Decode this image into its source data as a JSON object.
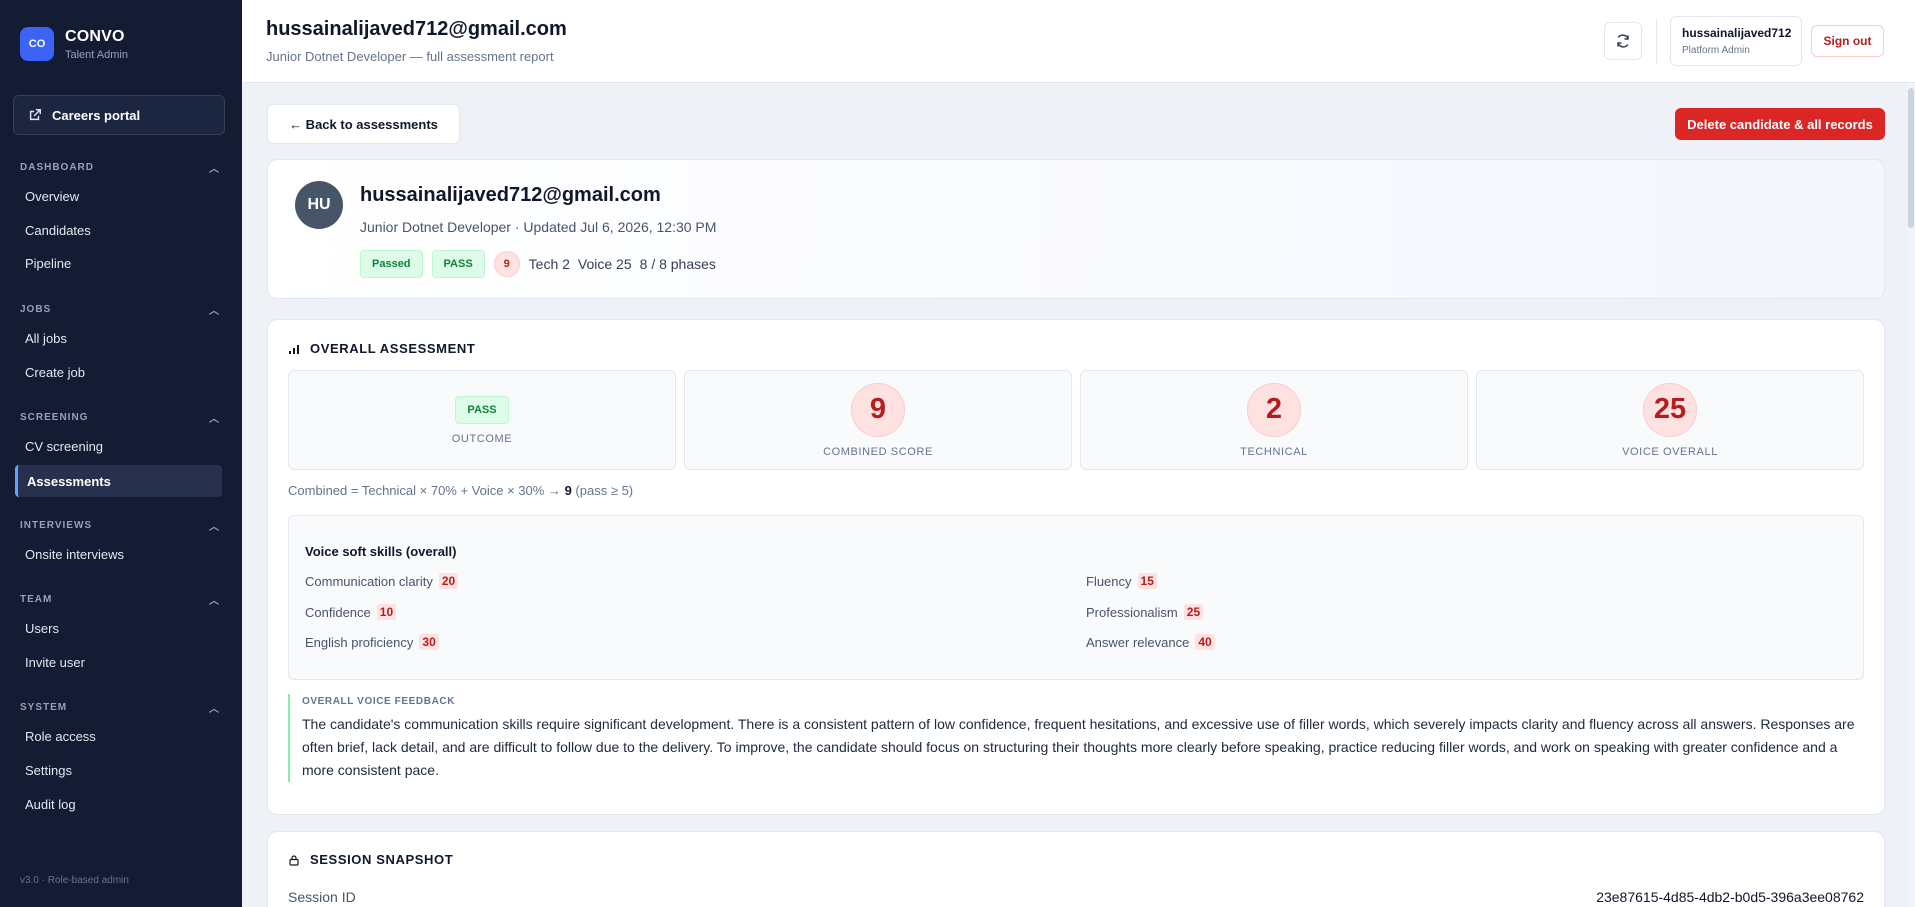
{
  "brand": {
    "logo": "CO",
    "name": "CONVO",
    "sub": "Talent Admin"
  },
  "sidebar": {
    "careers": "Careers portal",
    "sections": [
      {
        "title": "DASHBOARD",
        "items": [
          "Overview",
          "Candidates",
          "Pipeline"
        ]
      },
      {
        "title": "JOBS",
        "items": [
          "All jobs",
          "Create job"
        ]
      },
      {
        "title": "SCREENING",
        "items": [
          "CV screening",
          "Assessments"
        ]
      },
      {
        "title": "INTERVIEWS",
        "items": [
          "Onsite interviews"
        ]
      },
      {
        "title": "TEAM",
        "items": [
          "Users",
          "Invite user"
        ]
      },
      {
        "title": "SYSTEM",
        "items": [
          "Role access",
          "Settings",
          "Audit log"
        ]
      }
    ],
    "active": "Assessments",
    "version": "v3.0 · Role-based admin"
  },
  "header": {
    "title": "hussainalijaved712@gmail.com",
    "subtitle": "Junior Dotnet Developer — full assessment report",
    "user_name": "hussainalijaved712",
    "user_role": "Platform Admin",
    "signout": "Sign out"
  },
  "actions": {
    "back": "← Back to assessments",
    "delete": "Delete candidate & all records"
  },
  "profile": {
    "initials": "HU",
    "name": "hussainalijaved712@gmail.com",
    "meta": "Junior Dotnet Developer · Updated Jul 6, 2026, 12:30 PM",
    "status": "Passed",
    "outcome": "PASS",
    "score": "9",
    "tech": "Tech 2",
    "voice": "Voice 25",
    "phases": "8 / 8 phases"
  },
  "overall": {
    "heading": "OVERALL ASSESSMENT",
    "outcome_value": "PASS",
    "outcome_label": "OUTCOME",
    "combined_value": "9",
    "combined_label": "COMBINED SCORE",
    "technical_value": "2",
    "technical_label": "TECHNICAL",
    "voice_value": "25",
    "voice_label": "VOICE OVERALL",
    "formula_prefix": "Combined = Technical × 70% + Voice × 30% →",
    "formula_value": "9",
    "formula_suffix": "(pass ≥ 5)",
    "soft_title": "Voice soft skills (overall)",
    "skills": [
      {
        "label": "Communication clarity",
        "value": "20"
      },
      {
        "label": "Fluency",
        "value": "15"
      },
      {
        "label": "Confidence",
        "value": "10"
      },
      {
        "label": "Professionalism",
        "value": "25"
      },
      {
        "label": "English proficiency",
        "value": "30"
      },
      {
        "label": "Answer relevance",
        "value": "40"
      }
    ],
    "feedback_title": "OVERALL VOICE FEEDBACK",
    "feedback": "The candidate's communication skills require significant development. There is a consistent pattern of low confidence, frequent hesitations, and excessive use of filler words, which severely impacts clarity and fluency across all answers. Responses are often brief, lack detail, and are difficult to follow due to the delivery. To improve, the candidate should focus on structuring their thoughts more clearly before speaking, practice reducing filler words, and work on speaking with greater confidence and a more consistent pace."
  },
  "session": {
    "heading": "SESSION SNAPSHOT",
    "id_label": "Session ID",
    "id_value": "23e87615-4d85-4db2-b0d5-396a3ee08762"
  },
  "colors": {
    "sidebar": "#131c33",
    "accent": "#3b63f6",
    "danger": "#dc2626",
    "pass": "#15803d",
    "score": "#b91c1c"
  },
  "icons": [
    "external-link-icon",
    "chevron-up-icon",
    "refresh-icon",
    "bar-chart-icon",
    "lock-icon",
    "arrow-left-icon"
  ]
}
